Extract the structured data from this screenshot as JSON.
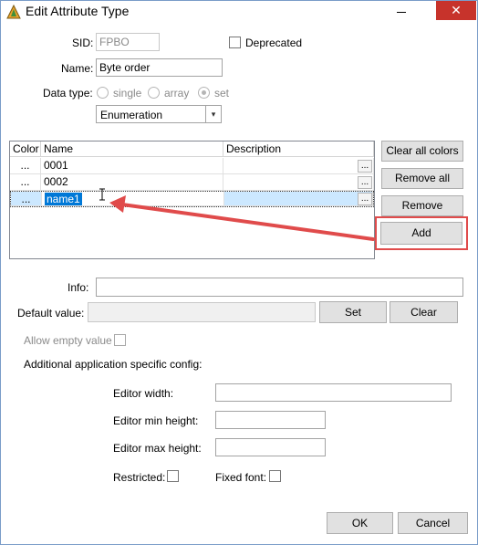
{
  "window": {
    "title": "Edit Attribute Type",
    "close_glyph": "✕"
  },
  "form": {
    "sid_label": "SID:",
    "sid_value": "FPBO",
    "deprecated_label": "Deprecated",
    "name_label": "Name:",
    "name_value": "Byte order",
    "data_type_label": "Data type:",
    "data_type_options": [
      "single",
      "array",
      "set"
    ],
    "data_type_selected": "set",
    "combo_value": "Enumeration",
    "combo_arrow": "▾"
  },
  "grid": {
    "columns": [
      "Color",
      "Name",
      "Description"
    ],
    "rows": [
      {
        "color": "...",
        "name": "0001",
        "description": "",
        "ellipsis": "..."
      },
      {
        "color": "...",
        "name": "0002",
        "description": "",
        "ellipsis": "..."
      },
      {
        "color": "...",
        "name": "name1",
        "description": "",
        "ellipsis": "..."
      }
    ]
  },
  "side_buttons": {
    "clear_all_colors": "Clear all colors",
    "remove_all": "Remove all",
    "remove": "Remove",
    "add": "Add"
  },
  "info_label": "Info:",
  "info_value": "",
  "default_value_label": "Default value:",
  "default_value": "",
  "set_button": "Set",
  "clear_button": "Clear",
  "allow_empty_label": "Allow empty value",
  "additional_config_label": "Additional application specific config:",
  "editor_width_label": "Editor width:",
  "editor_min_height_label": "Editor min height:",
  "editor_max_height_label": "Editor max height:",
  "restricted_label": "Restricted:",
  "fixed_font_label": "Fixed font:",
  "ok_button": "OK",
  "cancel_button": "Cancel",
  "colors": {
    "annotation_red": "#e04b4b",
    "selection_blue": "#0078d7",
    "row_highlight": "#cce8ff"
  }
}
